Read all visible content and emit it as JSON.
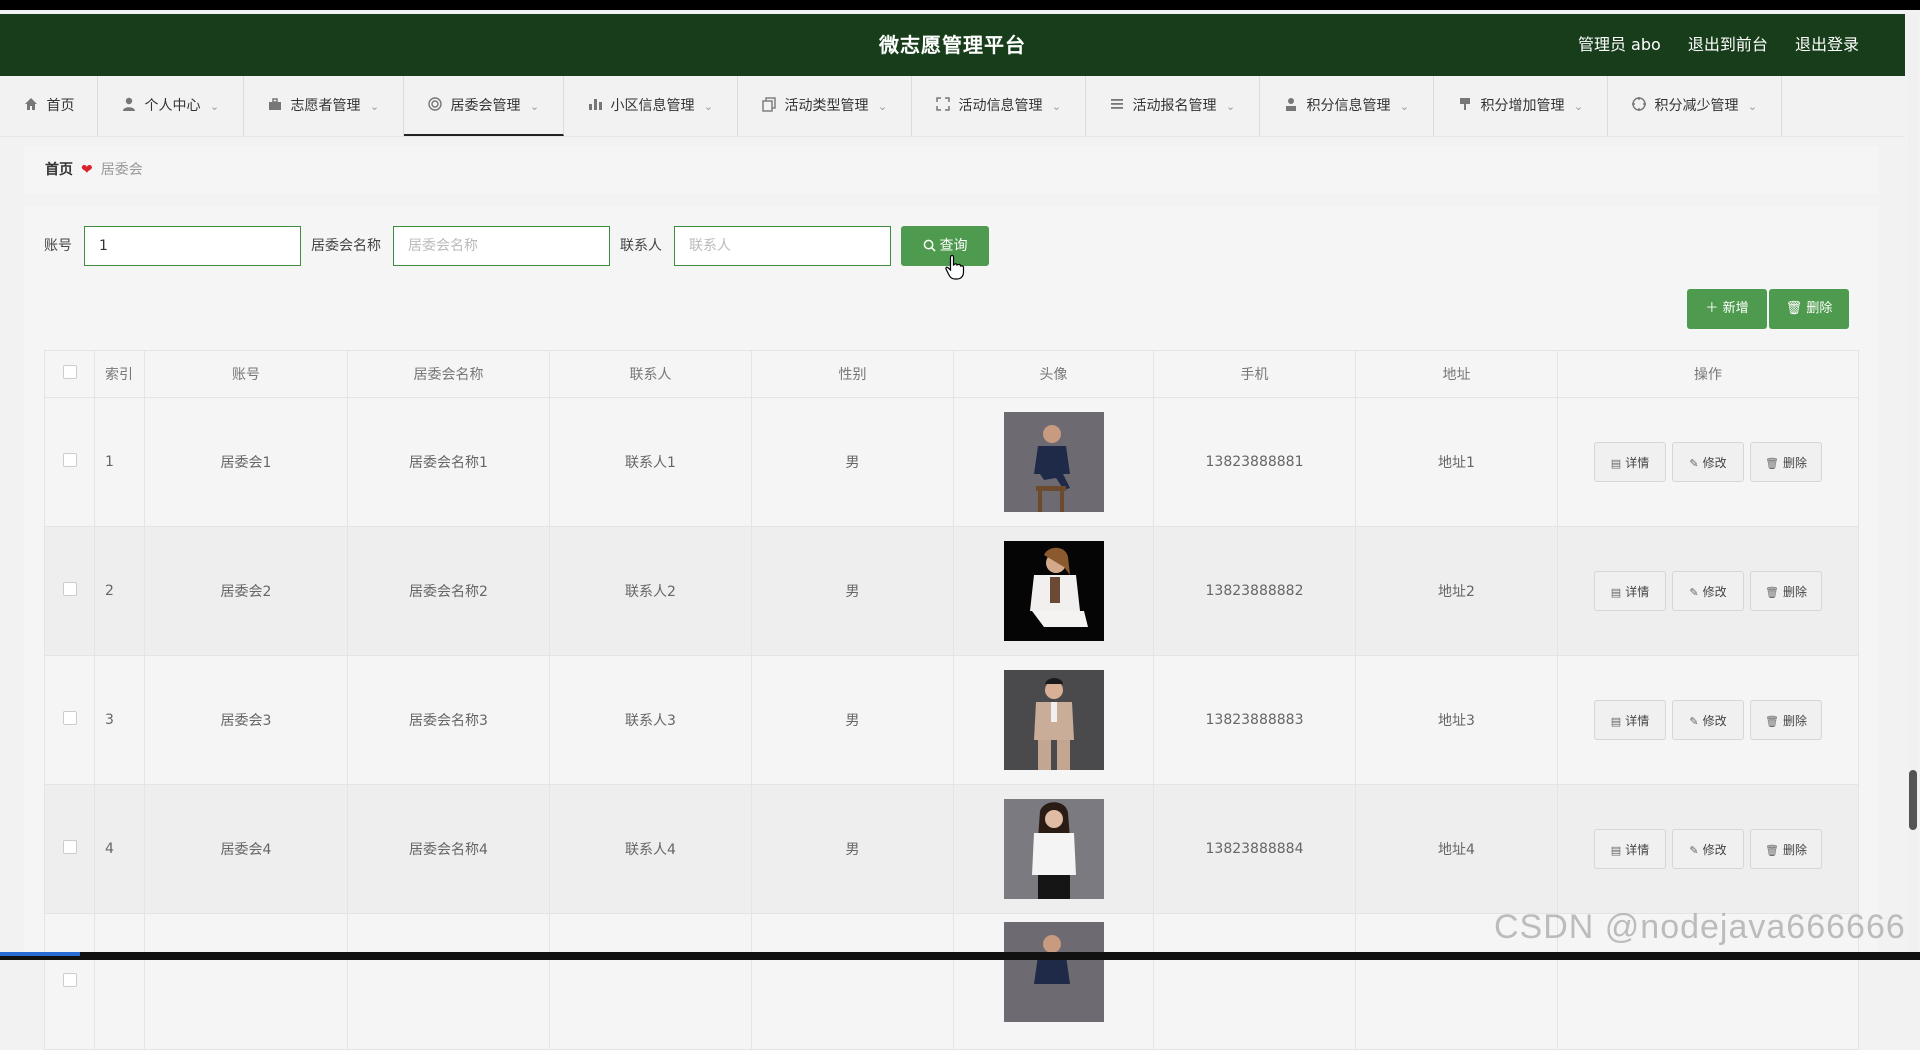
{
  "header": {
    "title": "微志愿管理平台",
    "user": "管理员 abo",
    "to_front": "退出到前台",
    "logout": "退出登录"
  },
  "nav": [
    {
      "label": "首页",
      "icon": "home-icon"
    },
    {
      "label": "个人中心",
      "icon": "user-icon"
    },
    {
      "label": "志愿者管理",
      "icon": "briefcase-icon"
    },
    {
      "label": "居委会管理",
      "icon": "target-icon"
    },
    {
      "label": "小区信息管理",
      "icon": "bar-chart-icon"
    },
    {
      "label": "活动类型管理",
      "icon": "copy-icon"
    },
    {
      "label": "活动信息管理",
      "icon": "fullscreen-icon"
    },
    {
      "label": "活动报名管理",
      "icon": "list-icon"
    },
    {
      "label": "积分信息管理",
      "icon": "person-icon"
    },
    {
      "label": "积分增加管理",
      "icon": "brush-icon"
    },
    {
      "label": "积分减少管理",
      "icon": "compass-icon"
    }
  ],
  "breadcrumb": {
    "home": "首页",
    "current": "居委会"
  },
  "search": {
    "account_label": "账号",
    "account_value": "1",
    "name_label": "居委会名称",
    "name_placeholder": "居委会名称",
    "contact_label": "联系人",
    "contact_placeholder": "联系人",
    "query_label": "查询"
  },
  "actions": {
    "add": "新增",
    "delete": "删除"
  },
  "table": {
    "headers": [
      "索引",
      "账号",
      "居委会名称",
      "联系人",
      "性别",
      "头像",
      "手机",
      "地址",
      "操作"
    ],
    "rows": [
      {
        "index": "1",
        "account": "居委会1",
        "name": "居委会名称1",
        "contact": "联系人1",
        "gender": "男",
        "phone": "13823888881",
        "address": "地址1"
      },
      {
        "index": "2",
        "account": "居委会2",
        "name": "居委会名称2",
        "contact": "联系人2",
        "gender": "男",
        "phone": "13823888882",
        "address": "地址2"
      },
      {
        "index": "3",
        "account": "居委会3",
        "name": "居委会名称3",
        "contact": "联系人3",
        "gender": "男",
        "phone": "13823888883",
        "address": "地址3"
      },
      {
        "index": "4",
        "account": "居委会4",
        "name": "居委会名称4",
        "contact": "联系人4",
        "gender": "男",
        "phone": "13823888884",
        "address": "地址4"
      }
    ],
    "row_actions": {
      "detail": "详情",
      "edit": "修改",
      "delete": "删除"
    }
  },
  "watermark": "CSDN @nodejava666666",
  "colors": {
    "header_bg": "#173d1b",
    "accent": "#4e9a4e",
    "heart": "#d9232d"
  }
}
